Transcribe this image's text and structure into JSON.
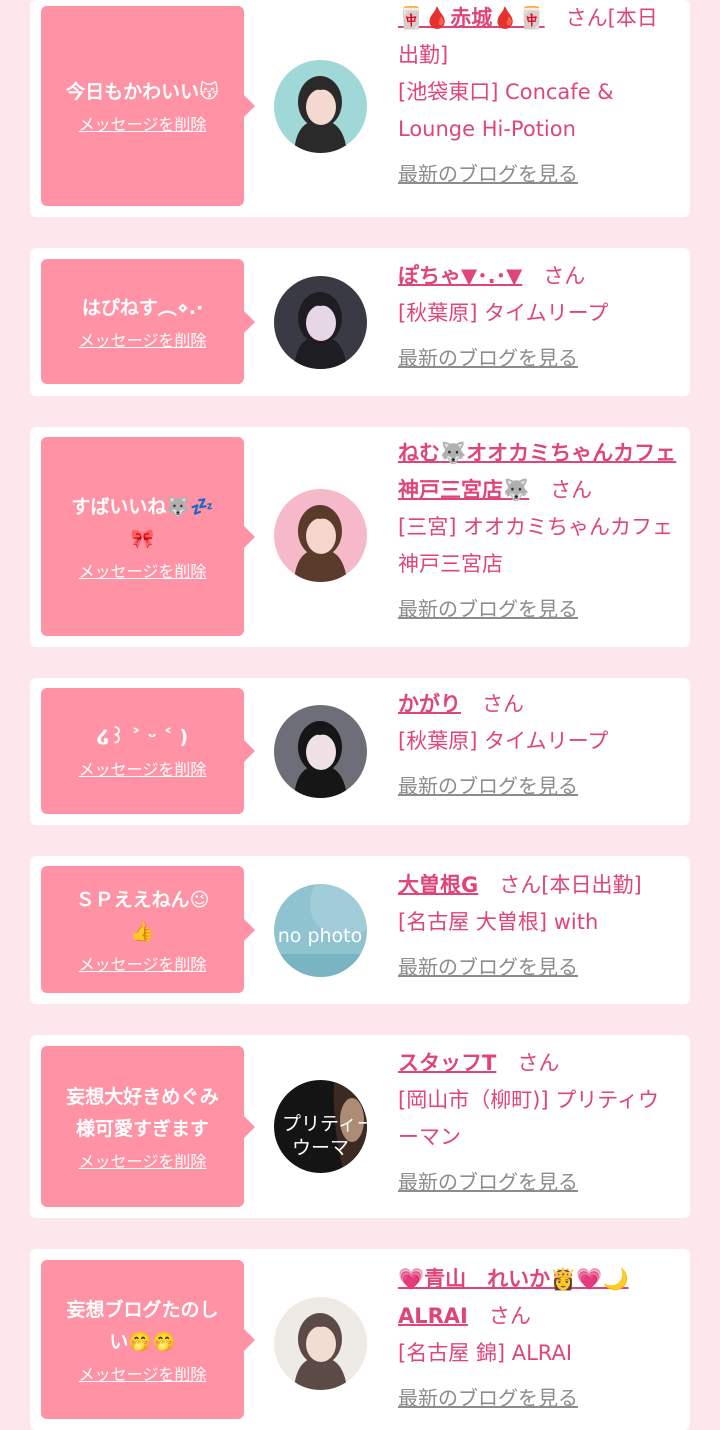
{
  "delete_label": "メッセージを削除",
  "honorific": "さん",
  "blog_link_label": "最新のブログを見る",
  "colors": {
    "page_background": "#fde7ec",
    "card_background": "#ffffff",
    "bubble": "#ff93a5",
    "accent": "#e0457a",
    "muted_link": "#8c8c8c"
  },
  "messages": [
    {
      "message": "今日もかわいい😽",
      "name": "🀄🩸赤城🩸🀄",
      "status": "[本日出勤]",
      "shop": "[池袋東口] Concafe & Lounge Hi-Potion",
      "avatar_icon": "cast-photo-icon"
    },
    {
      "message": "はぴねす︵⋄.·",
      "name": "ぽちゃ▼･.･▼",
      "status": "",
      "shop": "[秋葉原] タイムリープ",
      "avatar_icon": "cast-photo-icon"
    },
    {
      "message": "すばいいね🐺💤\n🎀",
      "name": "ねむ🐺オオカミちゃんカフェ神戸三宮店🐺",
      "status": "",
      "shop": "[三宮] オオカミちゃんカフェ神戸三宮店",
      "avatar_icon": "cast-photo-icon"
    },
    {
      "message": "໒꒱ ˃ ᵕ ˂ )",
      "name": "かがり",
      "status": "",
      "shop": "[秋葉原] タイムリープ",
      "avatar_icon": "cast-photo-icon"
    },
    {
      "message": "ＳＰええねん😉\n👍",
      "name": "大曽根G",
      "status": "[本日出勤]",
      "shop": "[名古屋 大曽根] with",
      "avatar_icon": "no-photo-icon",
      "avatar_text": "no photo"
    },
    {
      "message": "妄想大好きめぐみ\n様可愛すぎます",
      "name": "スタッフT",
      "status": "",
      "shop": "[岡山市（柳町)] プリティウーマン",
      "avatar_icon": "shop-logo-icon",
      "avatar_text": "プリティー\nウーマ"
    },
    {
      "message": "妄想ブログたのし\nい🤭🤭",
      "name": "💗青山　れいか👸💗🌙ALRAI",
      "status": "",
      "shop": "[名古屋 錦] ALRAI",
      "avatar_icon": "cast-photo-icon"
    }
  ]
}
